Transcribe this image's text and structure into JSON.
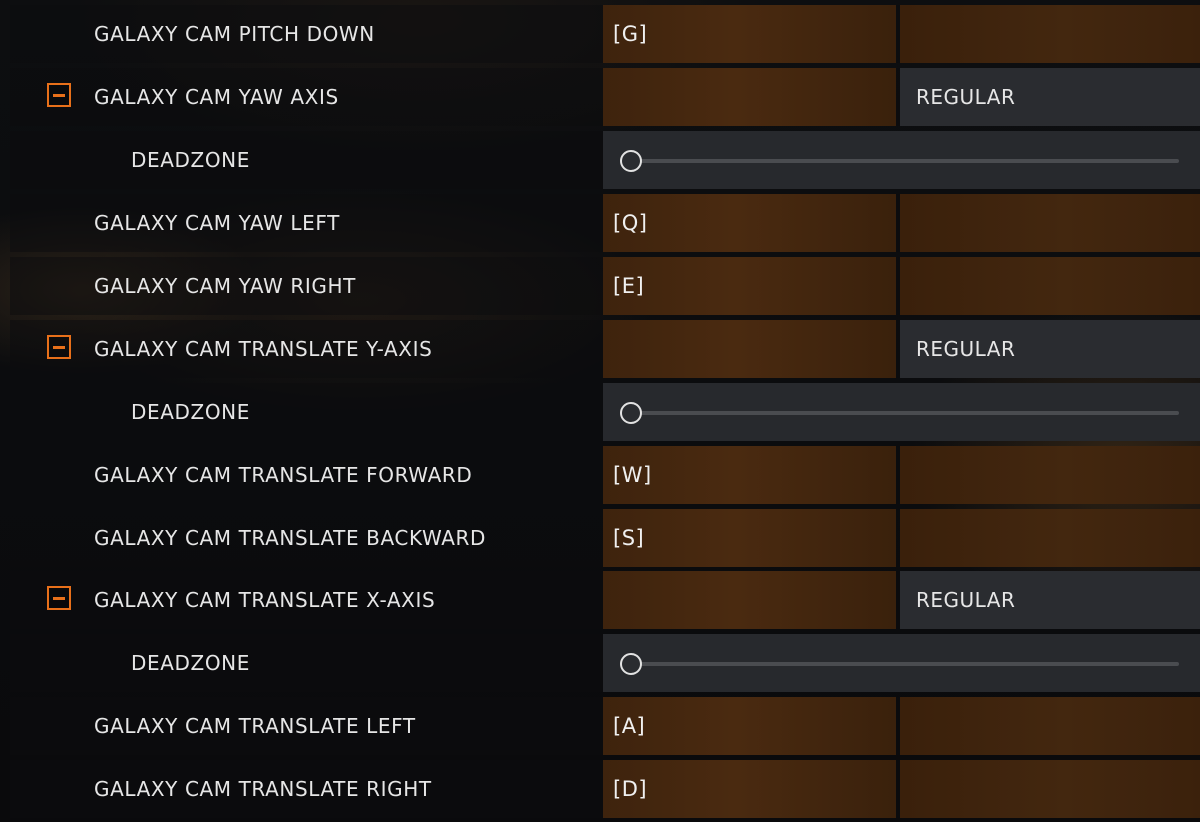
{
  "colors": {
    "accent": "#e8701a",
    "binding_fill": "#4a2a10",
    "panel_gray": "#2a2c30",
    "text": "#e6e6e6"
  },
  "rows": [
    {
      "label": "GALAXY CAM PITCH DOWN",
      "primary": "[G]",
      "secondary": ""
    },
    {
      "label": "GALAXY CAM YAW AXIS",
      "expander_icon": "collapse-minus-icon",
      "primary": "",
      "mode": "REGULAR"
    },
    {
      "label": "DEADZONE",
      "deadzone": 0
    },
    {
      "label": "GALAXY CAM YAW LEFT",
      "primary": "[Q]",
      "secondary": ""
    },
    {
      "label": "GALAXY CAM YAW RIGHT",
      "primary": "[E]",
      "secondary": ""
    },
    {
      "label": "GALAXY CAM TRANSLATE Y-AXIS",
      "expander_icon": "collapse-minus-icon",
      "primary": "",
      "mode": "REGULAR"
    },
    {
      "label": "DEADZONE",
      "deadzone": 0
    },
    {
      "label": "GALAXY CAM TRANSLATE FORWARD",
      "primary": "[W]",
      "secondary": ""
    },
    {
      "label": "GALAXY CAM TRANSLATE BACKWARD",
      "primary": "[S]",
      "secondary": ""
    },
    {
      "label": "GALAXY CAM TRANSLATE X-AXIS",
      "expander_icon": "collapse-minus-icon",
      "primary": "",
      "mode": "REGULAR"
    },
    {
      "label": "DEADZONE",
      "deadzone": 0
    },
    {
      "label": "GALAXY CAM TRANSLATE LEFT",
      "primary": "[A]",
      "secondary": ""
    },
    {
      "label": "GALAXY CAM TRANSLATE RIGHT",
      "primary": "[D]",
      "secondary": ""
    }
  ]
}
